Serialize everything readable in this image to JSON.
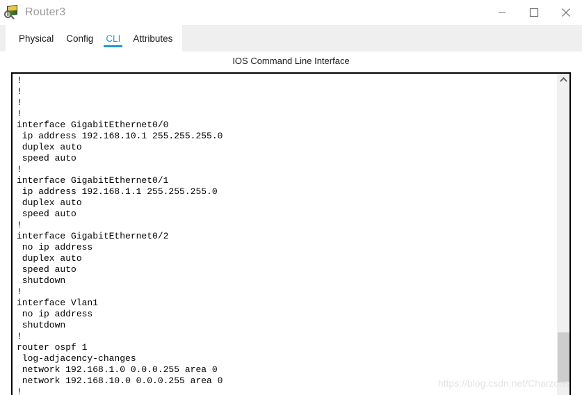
{
  "window": {
    "title": "Router3",
    "icon": "packet-tracer-device-icon",
    "controls": {
      "minimize_label": "Minimize",
      "maximize_label": "Maximize",
      "close_label": "Close"
    }
  },
  "tabs": [
    {
      "label": "Physical",
      "active": false
    },
    {
      "label": "Config",
      "active": false
    },
    {
      "label": "CLI",
      "active": true
    },
    {
      "label": "Attributes",
      "active": false
    }
  ],
  "panel": {
    "heading": "IOS Command Line Interface"
  },
  "terminal": {
    "lines": [
      "!",
      "!",
      "!",
      "!",
      "interface GigabitEthernet0/0",
      " ip address 192.168.10.1 255.255.255.0",
      " duplex auto",
      " speed auto",
      "!",
      "interface GigabitEthernet0/1",
      " ip address 192.168.1.1 255.255.255.0",
      " duplex auto",
      " speed auto",
      "!",
      "interface GigabitEthernet0/2",
      " no ip address",
      " duplex auto",
      " speed auto",
      " shutdown",
      "!",
      "interface Vlan1",
      " no ip address",
      " shutdown",
      "!",
      "router ospf 1",
      " log-adjacency-changes",
      " network 192.168.1.0 0.0.0.255 area 0",
      " network 192.168.10.0 0.0.0.255 area 0",
      "!"
    ]
  },
  "scrollbar": {
    "up_arrow": "chevron-up-icon"
  },
  "watermark": {
    "text": "https://blog.csdn.net/Charzous"
  },
  "colors": {
    "accent": "#1e9ad6",
    "title_text": "#9a9a9a",
    "tabstrip_bg": "#ffffff",
    "window_bg": "#efefef",
    "terminal_text": "#000000",
    "scrollbar_thumb": "#cdcdcd"
  }
}
